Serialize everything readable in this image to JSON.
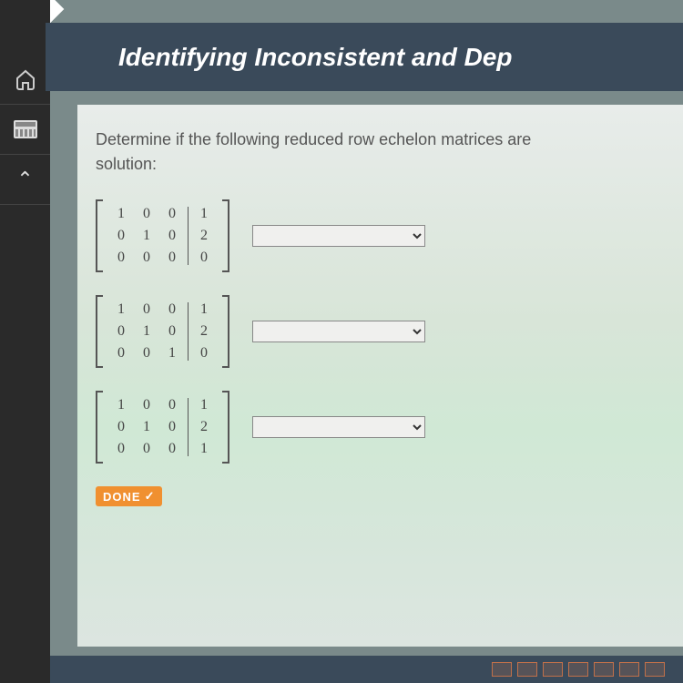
{
  "header": {
    "title": "Identifying Inconsistent and Dep"
  },
  "question": {
    "line1": "Determine if the following reduced row echelon matrices are",
    "line2": "solution:"
  },
  "matrices": [
    {
      "col1": [
        "1",
        "0",
        "0"
      ],
      "col2": [
        "0",
        "1",
        "0"
      ],
      "col3": [
        "0",
        "0",
        "0"
      ],
      "aug": [
        "1",
        "2",
        "0"
      ]
    },
    {
      "col1": [
        "1",
        "0",
        "0"
      ],
      "col2": [
        "0",
        "1",
        "0"
      ],
      "col3": [
        "0",
        "0",
        "1"
      ],
      "aug": [
        "1",
        "2",
        "0"
      ]
    },
    {
      "col1": [
        "1",
        "0",
        "0"
      ],
      "col2": [
        "0",
        "1",
        "0"
      ],
      "col3": [
        "0",
        "0",
        "0"
      ],
      "aug": [
        "1",
        "2",
        "1"
      ]
    }
  ],
  "doneButton": {
    "label": "DONE",
    "check": "✓"
  },
  "dropdownPlaceholder": ""
}
